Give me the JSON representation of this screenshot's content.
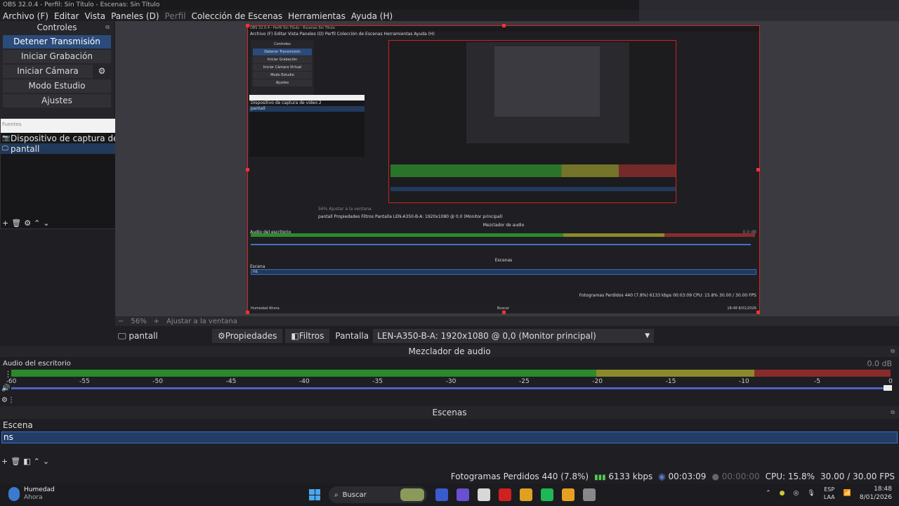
{
  "window": {
    "title": "OBS 32.0.4 - Perfil: Sin Título - Escenas: Sin Título"
  },
  "menu": [
    {
      "label": "Archivo (F)",
      "dim": false
    },
    {
      "label": "Editar",
      "dim": false
    },
    {
      "label": "Vista",
      "dim": false
    },
    {
      "label": "Paneles (D)",
      "dim": false
    },
    {
      "label": "Perfil",
      "dim": true
    },
    {
      "label": "Colección de Escenas",
      "dim": false
    },
    {
      "label": "Herramientas",
      "dim": false
    },
    {
      "label": "Ayuda (H)",
      "dim": false
    }
  ],
  "controls": {
    "title": "Controles",
    "stop_stream": "Detener Transmisión",
    "start_record": "Iniciar Grabación",
    "start_vcam": "Iniciar Cámara Virtual",
    "studio_mode": "Modo Estudio",
    "settings": "Ajustes"
  },
  "sources": {
    "title": "Fuentes",
    "items": [
      {
        "label": "Dispositivo de captura de video 2",
        "selected": false
      },
      {
        "label": "pantall",
        "selected": true
      }
    ]
  },
  "preview": {
    "inner": {
      "title": "OBS 32.0.4 - Perfil Sin Título - Escenas Sin Título",
      "menu": "Archivo (F)  Editar  Vista  Paneles (D)  Perfil  Colección de Escenas  Herramientas  Ayuda (H)",
      "controls": [
        "Controles",
        "Detener Transmisión",
        "Iniciar Grabación",
        "Iniciar Cámara Virtual",
        "Modo Estudio",
        "Ajustes"
      ],
      "sources": [
        "Dispositivo de captura de video 2",
        "pantall"
      ],
      "zoom": "56%   Ajustar a la ventana",
      "propbar": "pantall      Propiedades   Filtros   Pantalla   LEN-A350-B-A: 1920x1080 @ 0,0 (Monitor principal)",
      "mixer_title": "Mezclador de audio",
      "audio_channel": "Audio del escritorio",
      "db": "0.0 dB",
      "scenes_title": "Escenas",
      "scene_header": "Escena",
      "scene": "ns",
      "status": "Fotogramas Perdidos 440 (7.8%)   6133 kbps   00:03:09   CPU: 15.8% 30.00 / 30.00 FPS",
      "taskbar_weather": "Humedad",
      "taskbar_weather_sub": "Ahora",
      "taskbar_search": "Buscar",
      "taskbar_clock": "18:48",
      "taskbar_date": "8/01/2026"
    }
  },
  "zoom": {
    "minus": "−",
    "value": "56%",
    "plus": "+",
    "fit": "Ajustar a la ventana"
  },
  "propbar": {
    "source_name": "pantall",
    "properties": "Propiedades",
    "filters": "Filtros",
    "display_label": "Pantalla",
    "display_value": "LEN-A350-B-A: 1920x1080 @ 0,0 (Monitor principal)"
  },
  "mixer": {
    "title": "Mezclador de audio",
    "channel": "Audio del escritorio",
    "db": "0.0 dB",
    "ticks": [
      "-60",
      "-55",
      "-50",
      "-45",
      "-40",
      "-35",
      "-30",
      "-25",
      "-20",
      "-15",
      "-10",
      "-5",
      "0"
    ],
    "volume_level": 1.0
  },
  "scenes": {
    "title": "Escenas",
    "header": "Escena",
    "items": [
      "ns"
    ]
  },
  "status": {
    "dropped": "Fotogramas Perdidos 440 (7.8%)",
    "bitrate": "6133 kbps",
    "stream_time": "00:03:09",
    "record_time": "00:00:00",
    "cpu": "CPU: 15.8%",
    "fps": "30.00 / 30.00 FPS"
  },
  "taskbar": {
    "weather_title": "Humedad",
    "weather_sub": "Ahora",
    "search": "Buscar",
    "lang_top": "ESP",
    "lang_bottom": "LAA",
    "time": "18:48",
    "date": "8/01/2026",
    "app_colors": [
      "#3a5bd0",
      "#6a4fd0",
      "#d8d8d8",
      "#d02020",
      "#e0a020",
      "#1db954",
      "#e8a020",
      "#888888"
    ]
  },
  "colors": {
    "accent_selected": "#223d66",
    "active_button": "#2b4b7a",
    "border_red": "#dd2222"
  }
}
